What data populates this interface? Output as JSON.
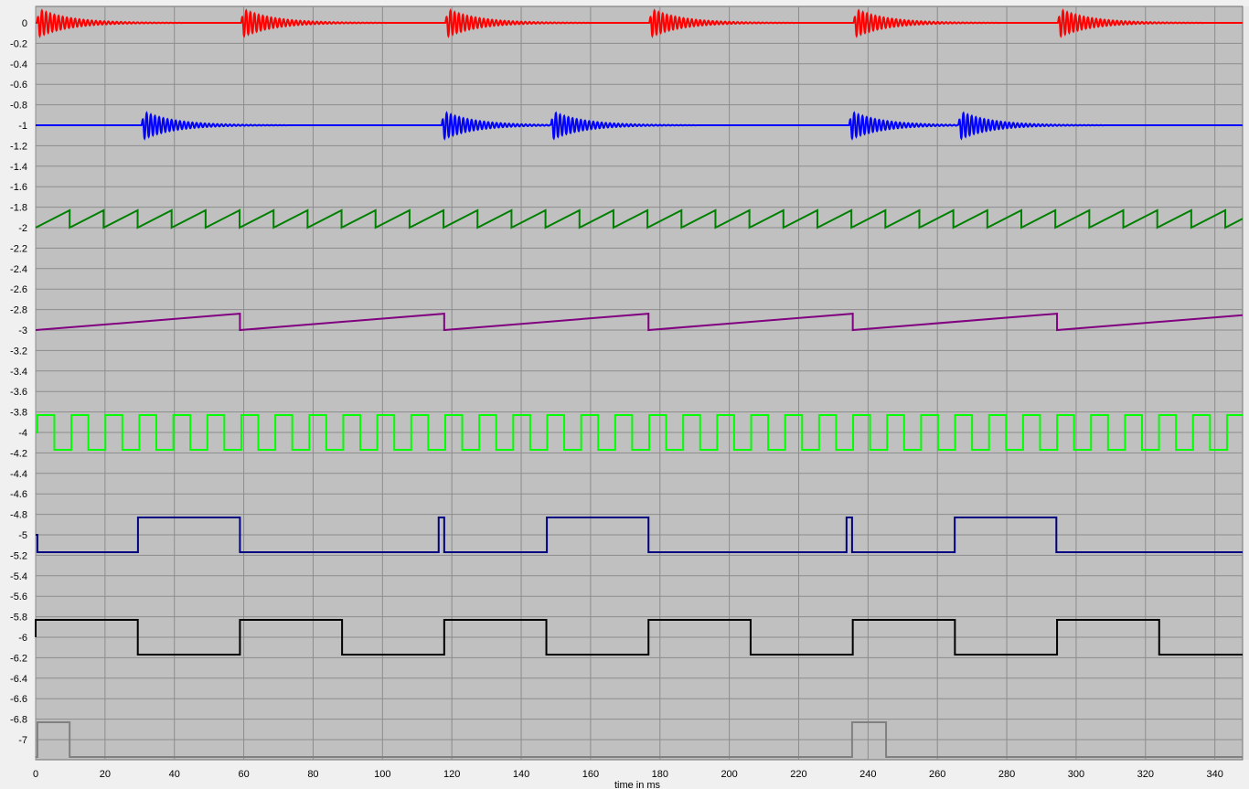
{
  "chart_data": {
    "type": "line",
    "xlabel": "time in ms",
    "ylabel": "",
    "xlim": [
      0,
      348
    ],
    "ylim": [
      -7.2,
      0.15
    ],
    "x_ticks": [
      0,
      20,
      40,
      60,
      80,
      100,
      120,
      140,
      160,
      180,
      200,
      220,
      240,
      260,
      280,
      300,
      320,
      340
    ],
    "y_ticks": [
      0,
      -0.2,
      -0.4,
      -0.6,
      -0.8,
      -1,
      -1.2,
      -1.4,
      -1.6,
      -1.8,
      -2,
      -2.2,
      -2.4,
      -2.6,
      -2.8,
      -3,
      -3.2,
      -3.4,
      -3.6,
      -3.8,
      -4,
      -4.2,
      -4.4,
      -4.6,
      -4.8,
      -5,
      -5.2,
      -5.4,
      -5.6,
      -5.8,
      -6,
      -6.2,
      -6.4,
      -6.6,
      -6.8,
      -7
    ],
    "grid": true,
    "background": "#c0c0c0",
    "grid_color": "#8c8c8c",
    "series": [
      {
        "kind": "burst",
        "color": "#ff0000",
        "baseline": 0,
        "amplitude": 0.14,
        "burst_starts": [
          0.3,
          59.2,
          118.1,
          176.9,
          235.8,
          294.7
        ],
        "burst_duration": 42,
        "osc_period_ms": 1.2,
        "decay_ms": 9
      },
      {
        "kind": "burst",
        "color": "#0000ff",
        "baseline": -1,
        "amplitude": 0.14,
        "burst_starts": [
          30.5,
          117,
          148.5,
          234.5,
          266
        ],
        "burst_duration": 42,
        "osc_period_ms": 1.2,
        "decay_ms": 9
      },
      {
        "kind": "sawtooth",
        "color": "#008000",
        "low": -2,
        "high": -1.83,
        "period": 9.8,
        "end": 348
      },
      {
        "kind": "sawtooth",
        "color": "#800080",
        "low": -3,
        "high": -2.84,
        "period": 58.9,
        "end": 348
      },
      {
        "kind": "square",
        "color": "#00ff00",
        "high": -3.83,
        "low": -4.17,
        "period": 9.8,
        "start_x": 0.5,
        "start_level": "high",
        "initial": -4,
        "end": 348
      },
      {
        "kind": "step",
        "color": "#000080",
        "points": [
          [
            0,
            -5
          ],
          [
            0.5,
            -5
          ],
          [
            0.5,
            -5.17
          ],
          [
            29.5,
            -5.17
          ],
          [
            29.5,
            -4.83
          ],
          [
            58.9,
            -4.83
          ],
          [
            58.9,
            -5.17
          ],
          [
            116.2,
            -5.17
          ],
          [
            116.2,
            -4.83
          ],
          [
            117.8,
            -4.83
          ],
          [
            117.8,
            -5.17
          ],
          [
            147.4,
            -5.17
          ],
          [
            147.4,
            -4.83
          ],
          [
            176.7,
            -4.83
          ],
          [
            176.7,
            -5.17
          ],
          [
            233.8,
            -5.17
          ],
          [
            233.8,
            -4.83
          ],
          [
            235.4,
            -4.83
          ],
          [
            235.4,
            -5.17
          ],
          [
            265,
            -5.17
          ],
          [
            265,
            -4.83
          ],
          [
            294.3,
            -4.83
          ],
          [
            294.3,
            -5.17
          ],
          [
            348,
            -5.17
          ]
        ]
      },
      {
        "kind": "square",
        "color": "#000000",
        "high": -5.83,
        "low": -6.17,
        "period": 58.9,
        "start_x": 0,
        "start_level": "high",
        "initial": -6,
        "end": 348
      },
      {
        "kind": "step",
        "color": "#808080",
        "points": [
          [
            0,
            -7.17
          ],
          [
            0.5,
            -7.17
          ],
          [
            0.5,
            -6.83
          ],
          [
            9.8,
            -6.83
          ],
          [
            9.8,
            -7.17
          ],
          [
            235.4,
            -7.17
          ],
          [
            235.4,
            -6.83
          ],
          [
            245.2,
            -6.83
          ],
          [
            245.2,
            -7.17
          ],
          [
            348,
            -7.17
          ]
        ]
      }
    ]
  }
}
